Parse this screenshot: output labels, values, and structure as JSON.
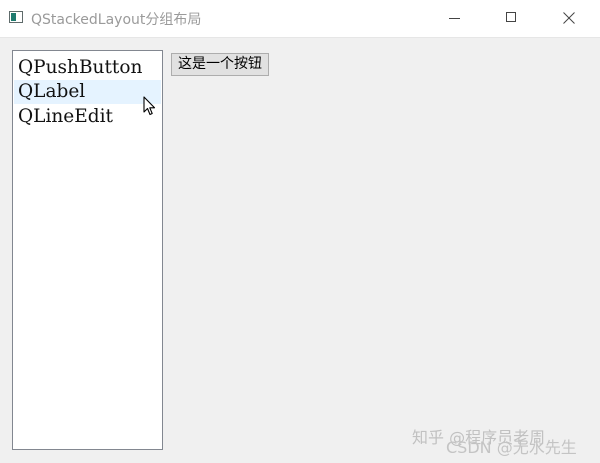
{
  "window": {
    "title": "QStackedLayout分组布局"
  },
  "list": {
    "items": [
      {
        "label": "QPushButton"
      },
      {
        "label": "QLabel"
      },
      {
        "label": "QLineEdit"
      }
    ],
    "hovered_index": 1
  },
  "stack": {
    "button_label": "这是一个按钮"
  },
  "watermark": {
    "line1": "知乎 @程序员老周",
    "line2": "CSDN @无水先生"
  },
  "colors": {
    "hover": "#e5f3ff",
    "app_icon": "#1e7a6e"
  },
  "icons": [
    "app-icon",
    "minimize-icon",
    "maximize-icon",
    "close-icon",
    "mouse-cursor-icon"
  ]
}
